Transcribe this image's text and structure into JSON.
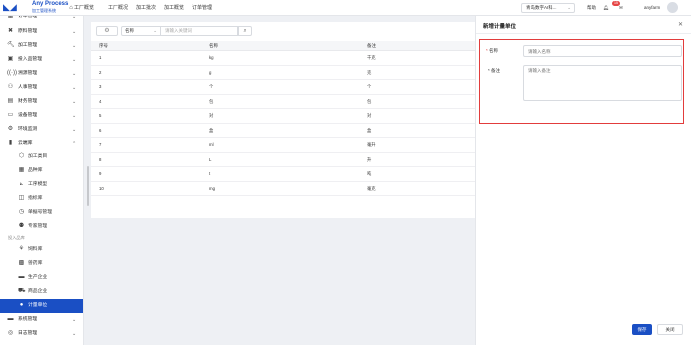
{
  "app": {
    "logo_title": "Any Process",
    "logo_subtitle": "加工管理系统"
  },
  "topnav": [
    {
      "label": "工厂概览",
      "icon": "home-icon"
    },
    {
      "label": "工厂概况"
    },
    {
      "label": "加工批次"
    },
    {
      "label": "加工概览"
    },
    {
      "label": "订单管理"
    }
  ],
  "header": {
    "org_select": "青岛数字AI科...",
    "help": "帮助",
    "notification_count": "15",
    "user": "anyfarm"
  },
  "sidebar": {
    "items": [
      {
        "label": "订单管理",
        "icon": "grid-icon",
        "arrow": "⌄"
      },
      {
        "label": "原料管理",
        "icon": "cross-icon",
        "arrow": "⌄"
      },
      {
        "label": "加工管理",
        "icon": "hammer-icon",
        "arrow": "⌄"
      },
      {
        "label": "投入品管理",
        "icon": "box-icon",
        "arrow": "⌄"
      },
      {
        "label": "溯源管理",
        "icon": "signal-icon",
        "arrow": "⌄"
      },
      {
        "label": "人事管理",
        "icon": "person-icon",
        "arrow": "⌄"
      },
      {
        "label": "财务管理",
        "icon": "wallet-icon",
        "arrow": "⌄"
      },
      {
        "label": "设备管理",
        "icon": "device-icon",
        "arrow": "⌄"
      },
      {
        "label": "环境监测",
        "icon": "gear-icon",
        "arrow": "⌄"
      },
      {
        "label": "云端库",
        "icon": "book-icon",
        "arrow": "⌃"
      }
    ],
    "subitems": [
      {
        "label": "加工类目",
        "icon": "cube-icon"
      },
      {
        "label": "品种库",
        "icon": "table-icon"
      },
      {
        "label": "工序模型",
        "icon": "flow-icon"
      },
      {
        "label": "指标库",
        "icon": "tag-icon"
      },
      {
        "label": "单据号管理",
        "icon": "clock-icon"
      },
      {
        "label": "专家管理",
        "icon": "people-icon"
      }
    ],
    "group_label": "投入品库",
    "subitems2": [
      {
        "label": "饲料库",
        "icon": "leaf-icon"
      },
      {
        "label": "兽药库",
        "icon": "bottle-icon"
      },
      {
        "label": "生产企业",
        "icon": "factory-icon"
      },
      {
        "label": "商品企业",
        "icon": "cart-icon"
      },
      {
        "label": "计量单位",
        "icon": "drop-icon"
      }
    ],
    "bottom": [
      {
        "label": "系统管理",
        "icon": "system-icon",
        "arrow": "⌄"
      },
      {
        "label": "日志管理",
        "icon": "log-icon",
        "arrow": "⌄"
      }
    ]
  },
  "filter": {
    "field": "名称",
    "placeholder": "请输入关键词"
  },
  "table": {
    "headers": [
      "序号",
      "名称",
      "备注"
    ],
    "rows": [
      [
        "1",
        "kg",
        "千克"
      ],
      [
        "2",
        "g",
        "克"
      ],
      [
        "3",
        "个",
        "个"
      ],
      [
        "4",
        "包",
        "包"
      ],
      [
        "5",
        "对",
        "对"
      ],
      [
        "6",
        "盒",
        "盒"
      ],
      [
        "7",
        "ml",
        "毫升"
      ],
      [
        "8",
        "L",
        "升"
      ],
      [
        "9",
        "t",
        "吨"
      ],
      [
        "10",
        "mg",
        "毫克"
      ]
    ]
  },
  "drawer": {
    "title": "新增计量单位",
    "name_label": "名称",
    "name_placeholder": "请输入名称",
    "remark_label": "备注",
    "remark_placeholder": "请输入备注",
    "save": "保存",
    "close": "关闭"
  },
  "colors": {
    "primary": "#1a4fc4",
    "highlight_border": "#e23c3c"
  }
}
